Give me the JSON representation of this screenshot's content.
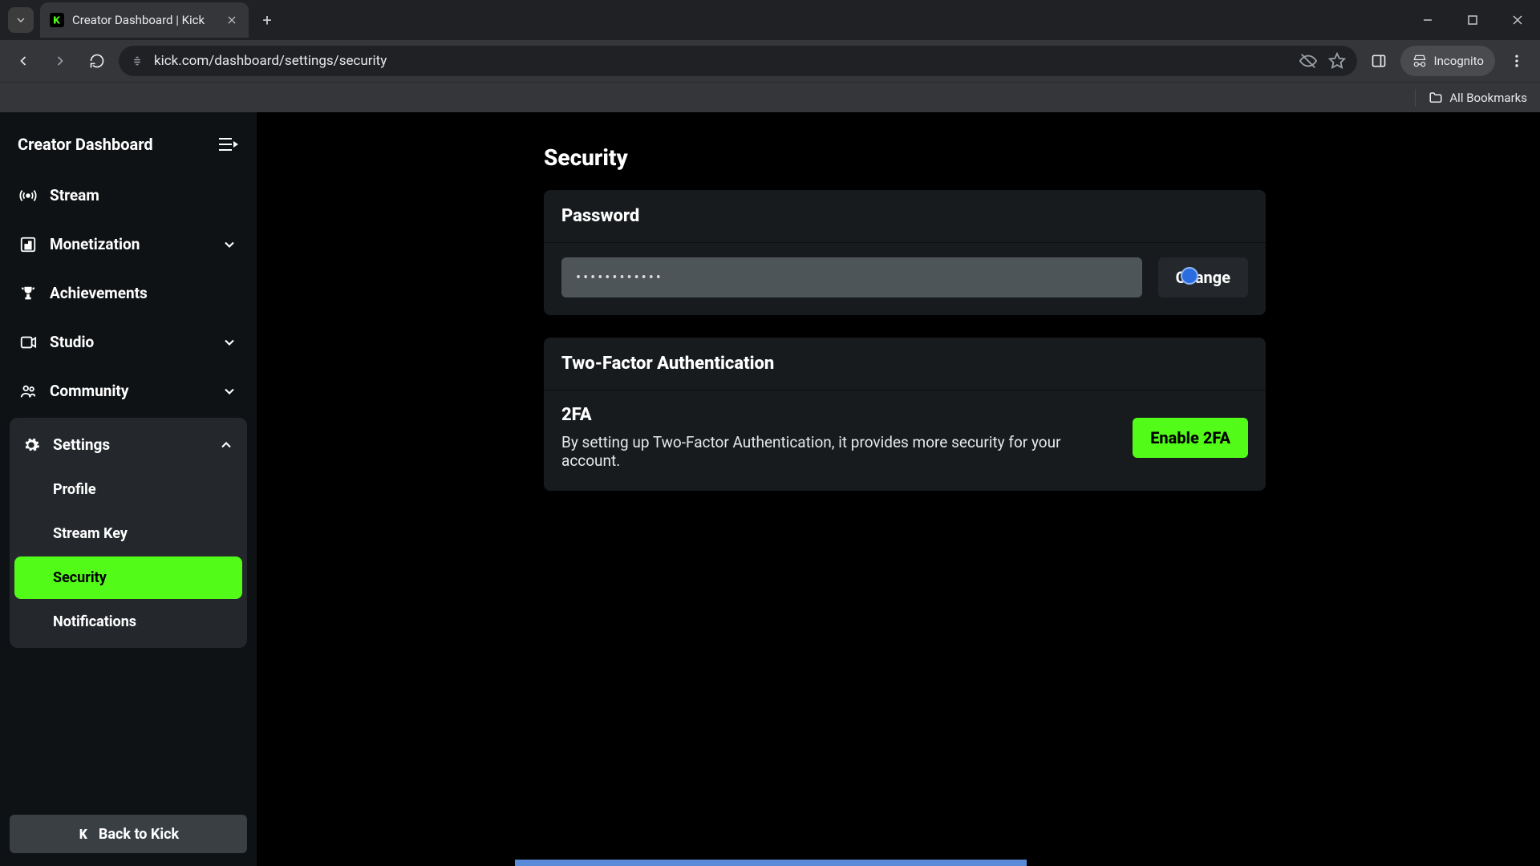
{
  "browser": {
    "tab_title": "Creator Dashboard | Kick",
    "url": "kick.com/dashboard/settings/security",
    "incognito_label": "Incognito",
    "all_bookmarks": "All Bookmarks"
  },
  "sidebar": {
    "title": "Creator Dashboard",
    "items": [
      {
        "label": "Stream"
      },
      {
        "label": "Monetization"
      },
      {
        "label": "Achievements"
      },
      {
        "label": "Studio"
      },
      {
        "label": "Community"
      },
      {
        "label": "Settings"
      }
    ],
    "settings_sub": [
      {
        "label": "Profile"
      },
      {
        "label": "Stream Key"
      },
      {
        "label": "Security"
      },
      {
        "label": "Notifications"
      }
    ],
    "back_label": "Back to Kick"
  },
  "page": {
    "title": "Security",
    "password": {
      "header": "Password",
      "value": "••••••••••••",
      "change_label": "Change"
    },
    "tfa": {
      "header": "Two-Factor Authentication",
      "title": "2FA",
      "desc": "By setting up Two-Factor Authentication, it provides more security for your account.",
      "enable_label": "Enable 2FA"
    }
  }
}
